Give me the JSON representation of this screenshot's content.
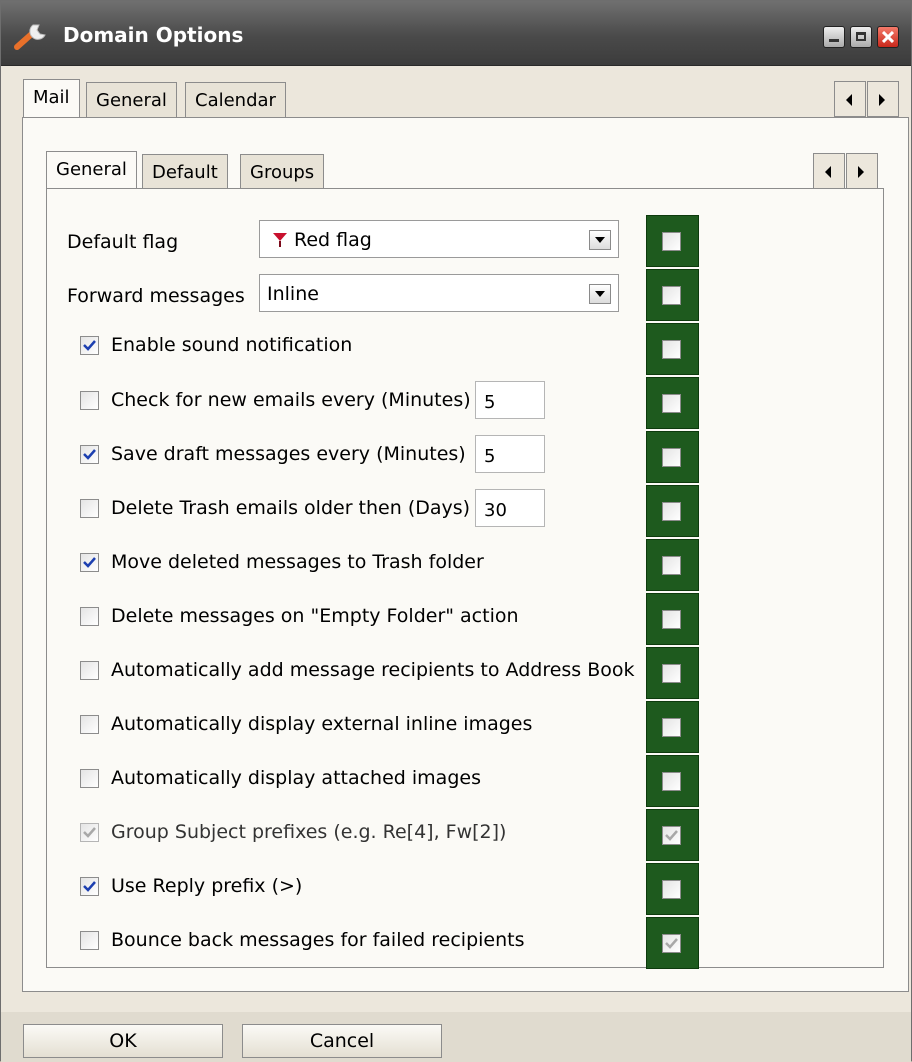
{
  "window": {
    "title": "Domain Options"
  },
  "outer_tabs": [
    {
      "label": "Mail"
    },
    {
      "label": "General"
    },
    {
      "label": "Calendar"
    }
  ],
  "inner_tabs": [
    {
      "label": "General"
    },
    {
      "label": "Default"
    },
    {
      "label": "Groups"
    }
  ],
  "fields": {
    "default_flag": {
      "label": "Default flag",
      "value": "Red flag"
    },
    "forward_messages": {
      "label": "Forward messages",
      "value": "Inline"
    }
  },
  "options": [
    {
      "label": "Enable sound notification",
      "checked": true
    },
    {
      "label": "Check for new emails every (Minutes)",
      "checked": false,
      "value": "5"
    },
    {
      "label": "Save draft messages every (Minutes)",
      "checked": true,
      "value": "5"
    },
    {
      "label": "Delete Trash emails older then (Days)",
      "checked": false,
      "value": "30"
    },
    {
      "label": "Move deleted messages to Trash folder",
      "checked": true
    },
    {
      "label": "Delete messages on \"Empty Folder\" action",
      "checked": false
    },
    {
      "label": "Automatically add message recipients to Address Book",
      "checked": false
    },
    {
      "label": "Automatically display external inline images",
      "checked": false
    },
    {
      "label": "Automatically display attached images",
      "checked": false
    },
    {
      "label": "Group Subject prefixes (e.g. Re[4], Fw[2])",
      "checked": true,
      "disabled": true
    },
    {
      "label": "Use Reply prefix (>)",
      "checked": true
    },
    {
      "label": "Bounce back messages for failed recipients",
      "checked": false
    }
  ],
  "lock_checkboxes": [
    false,
    false,
    false,
    false,
    false,
    false,
    false,
    false,
    false,
    false,
    false,
    true,
    false,
    true
  ],
  "buttons": {
    "ok": "OK",
    "cancel": "Cancel"
  },
  "colors": {
    "lock_column": "#1e5a1e",
    "flag": "#c8102e"
  }
}
